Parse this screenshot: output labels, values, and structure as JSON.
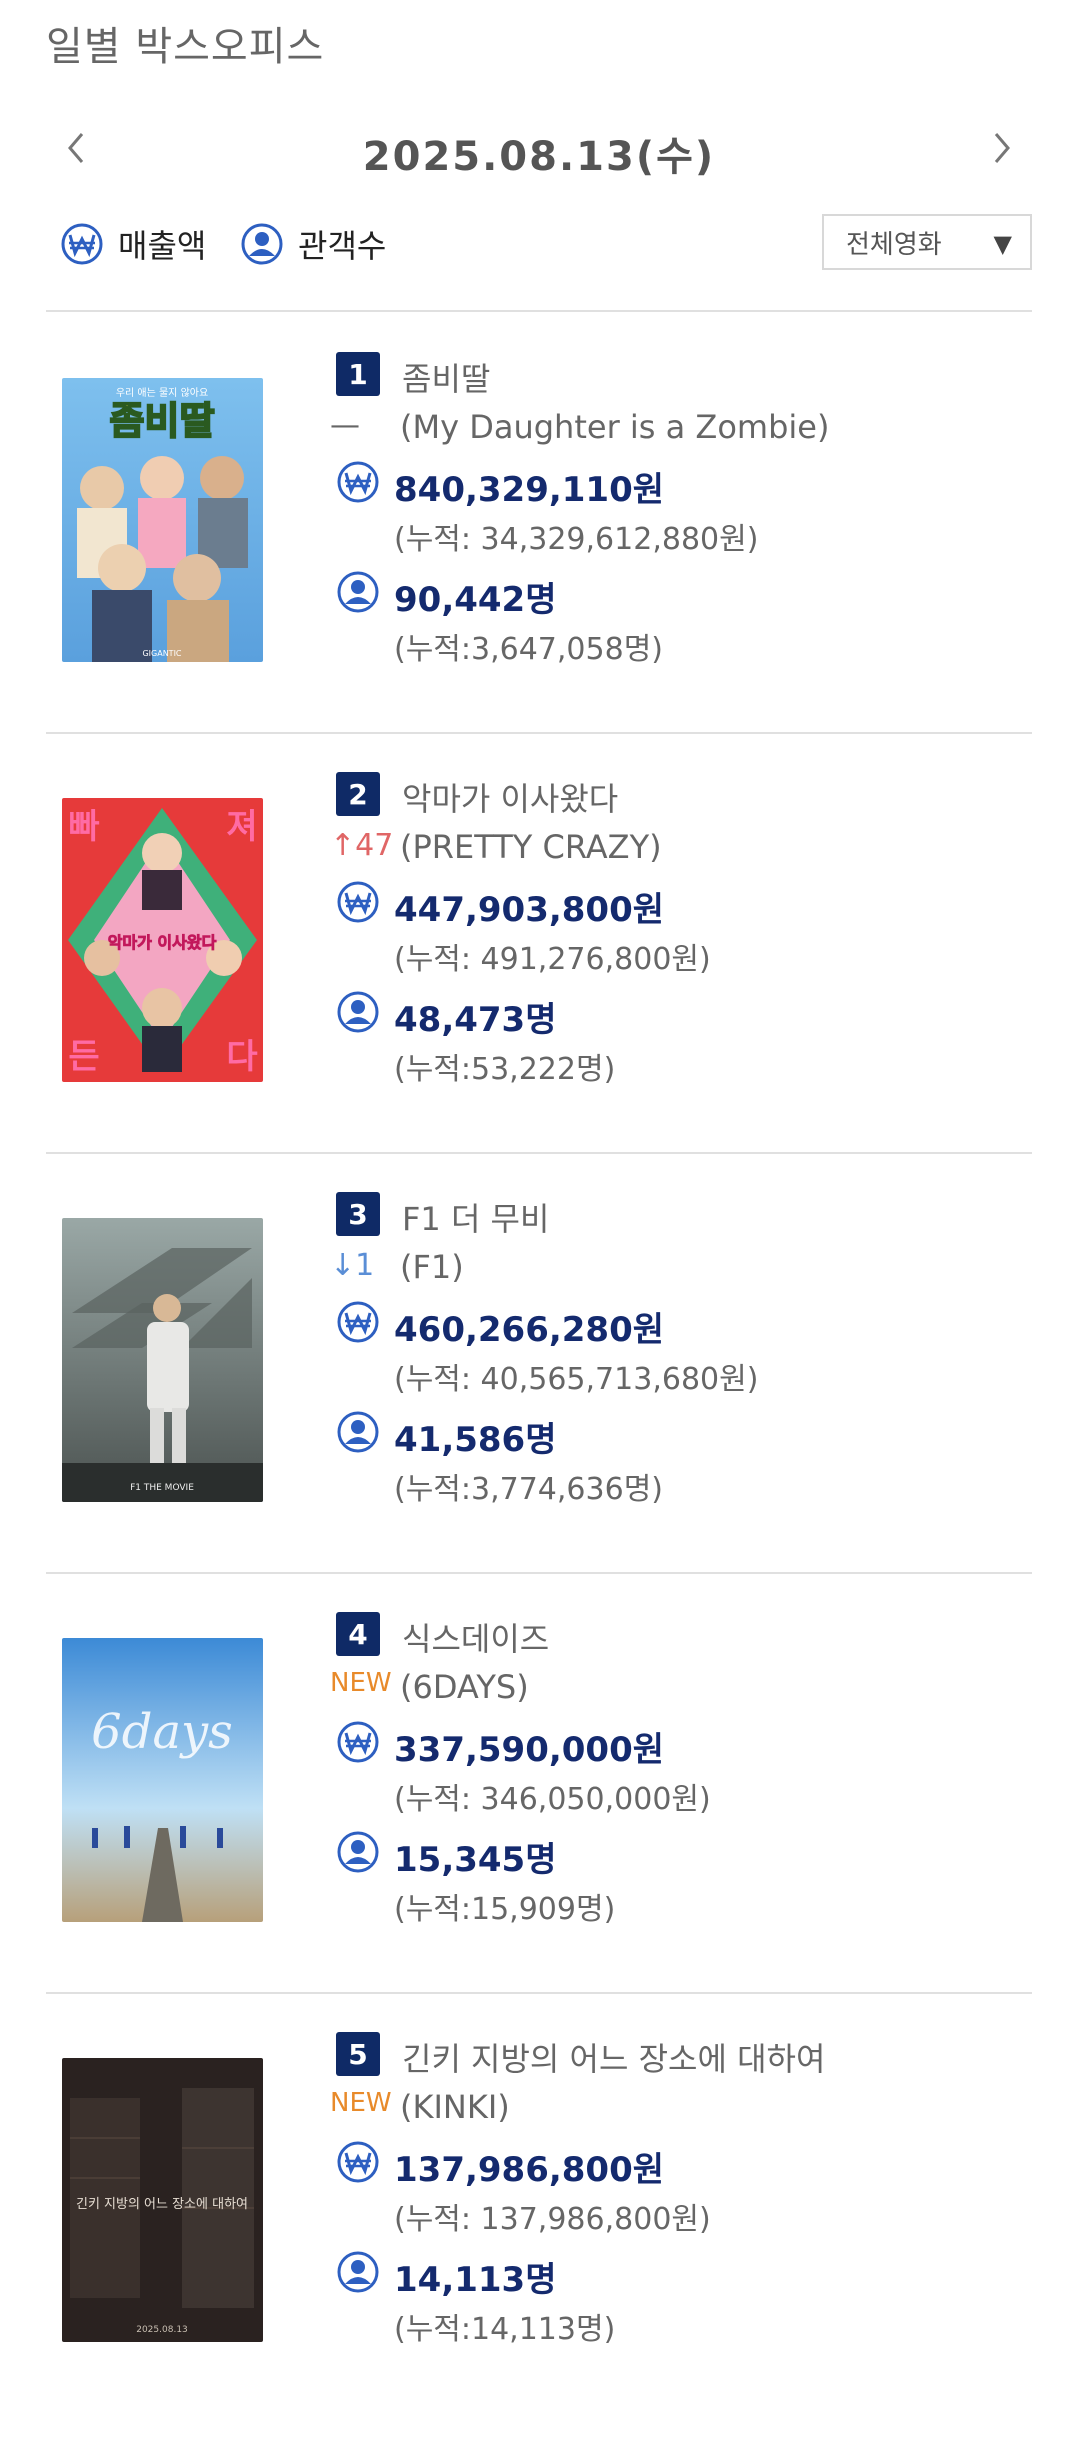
{
  "page_title": "일별 박스오피스",
  "date": "2025.08.13(수)",
  "toggles": {
    "sales_label": "매출액",
    "audience_label": "관객수"
  },
  "filter": {
    "selected": "전체영화"
  },
  "colors": {
    "rank_bg": "#0f2a66",
    "value_text": "#142a6e",
    "up": "#e06666",
    "down": "#5a8ed6",
    "new": "#e88a2a",
    "icon_blue": "#2d5fc1"
  },
  "entries": [
    {
      "rank": "1",
      "title": "좀비딸",
      "change": "—",
      "change_type": "same",
      "english_title": "(My Daughter is a Zombie)",
      "sales": "840,329,110원",
      "sales_total": "(누적: 34,329,612,880원)",
      "audience": "90,442명",
      "audience_total": "(누적:3,647,058명)",
      "poster": {
        "top_text": "우리 애는 물지 않아요",
        "title": "좀비딸",
        "bottom_text": "GIGANTIC"
      }
    },
    {
      "rank": "2",
      "title": "악마가 이사왔다",
      "change": "↑47",
      "change_type": "up",
      "english_title": "(PRETTY CRAZY)",
      "sales": "447,903,800원",
      "sales_total": "(누적: 491,276,800원)",
      "audience": "48,473명",
      "audience_total": "(누적:53,222명)",
      "poster": {
        "c1": "빠",
        "c2": "져",
        "c3": "든",
        "c4": "다",
        "title": "악마가 이사왔다"
      }
    },
    {
      "rank": "3",
      "title": "F1 더 무비",
      "change": "↓1",
      "change_type": "down",
      "english_title": "(F1)",
      "sales": "460,266,280원",
      "sales_total": "(누적: 40,565,713,680원)",
      "audience": "41,586명",
      "audience_total": "(누적:3,774,636명)",
      "poster": {
        "title": "F1 THE MOVIE"
      }
    },
    {
      "rank": "4",
      "title": "식스데이즈",
      "change": "NEW",
      "change_type": "new",
      "english_title": "(6DAYS)",
      "sales": "337,590,000원",
      "sales_total": "(누적: 346,050,000원)",
      "audience": "15,345명",
      "audience_total": "(누적:15,909명)",
      "poster": {
        "title": "6days"
      }
    },
    {
      "rank": "5",
      "title": "긴키 지방의 어느 장소에 대하여",
      "change": "NEW",
      "change_type": "new",
      "english_title": "(KINKI)",
      "sales": "137,986,800원",
      "sales_total": "(누적: 137,986,800원)",
      "audience": "14,113명",
      "audience_total": "(누적:14,113명)",
      "poster": {
        "title": "긴키 지방의 어느 장소에 대하여",
        "date": "2025.08.13"
      }
    }
  ]
}
